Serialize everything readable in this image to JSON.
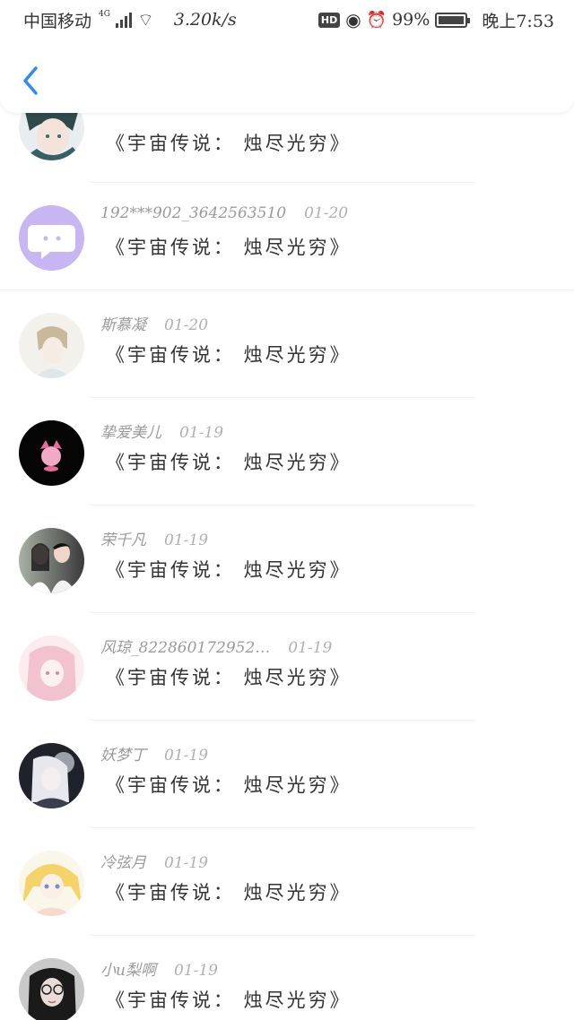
{
  "status_bar": {
    "carrier": "中国移动",
    "network": "4G",
    "speed": "3.20k/s",
    "hd": "HD",
    "battery": "99%",
    "battery_level": 0.99,
    "time": "晚上7:53"
  },
  "nav": {
    "back_icon": "chevron-left-icon",
    "accent": "#2f8fe8"
  },
  "messages": [
    {
      "name": "",
      "date": "",
      "text": "《宇宙传说： 烛尽光穷》"
    },
    {
      "name": "192***902_3642563510",
      "date": "01-20",
      "text": "《宇宙传说： 烛尽光穷》"
    },
    {
      "name": "斯慕凝",
      "date": "01-20",
      "text": "《宇宙传说： 烛尽光穷》"
    },
    {
      "name": "挚爱美儿",
      "date": "01-19",
      "text": "《宇宙传说： 烛尽光穷》"
    },
    {
      "name": "荣千凡",
      "date": "01-19",
      "text": "《宇宙传说： 烛尽光穷》"
    },
    {
      "name": "风琼_822860172952…",
      "date": "01-19",
      "text": "《宇宙传说： 烛尽光穷》"
    },
    {
      "name": "妖梦丁",
      "date": "01-19",
      "text": "《宇宙传说： 烛尽光穷》"
    },
    {
      "name": "冷弦月",
      "date": "01-19",
      "text": "《宇宙传说： 烛尽光穷》"
    },
    {
      "name": "小u梨啊",
      "date": "01-19",
      "text": "《宇宙传说： 烛尽光穷》"
    }
  ]
}
